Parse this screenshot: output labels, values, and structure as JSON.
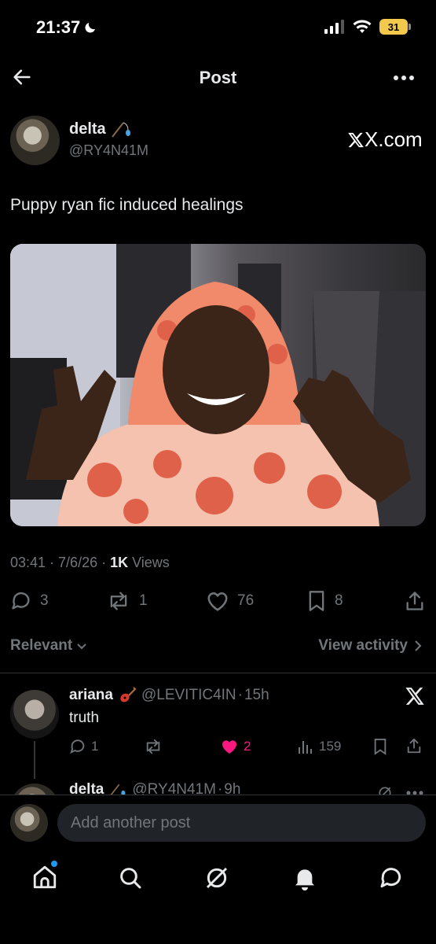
{
  "status_bar": {
    "time": "21:37",
    "battery": "31"
  },
  "header": {
    "title": "Post"
  },
  "post": {
    "author_name": "delta",
    "author_handle": "@RY4N41M",
    "source_label": "X.com",
    "text": "Puppy ryan fic induced healings",
    "meta_time": "03:41",
    "meta_sep": "·",
    "meta_date": "7/6/26",
    "meta_views_count": "1K",
    "meta_views_label": "Views",
    "replies": "3",
    "reposts": "1",
    "likes": "76",
    "bookmarks": "8"
  },
  "sort": {
    "label": "Relevant",
    "view_activity": "View activity"
  },
  "replies": [
    {
      "name": "ariana",
      "handle": "@LEVITIC4IN",
      "sep": "·",
      "time": "15h",
      "text": "truth",
      "reply_count": "1",
      "like_count": "2",
      "view_count": "159"
    },
    {
      "name": "delta",
      "handle": "@RY4N41M",
      "sep": "·",
      "time": "9h"
    }
  ],
  "composer": {
    "placeholder": "Add another post"
  },
  "colors": {
    "background": "#000000",
    "muted": "#71767b",
    "like_active": "#f91880",
    "accent": "#1d9bf0",
    "battery": "#f2c94c"
  }
}
